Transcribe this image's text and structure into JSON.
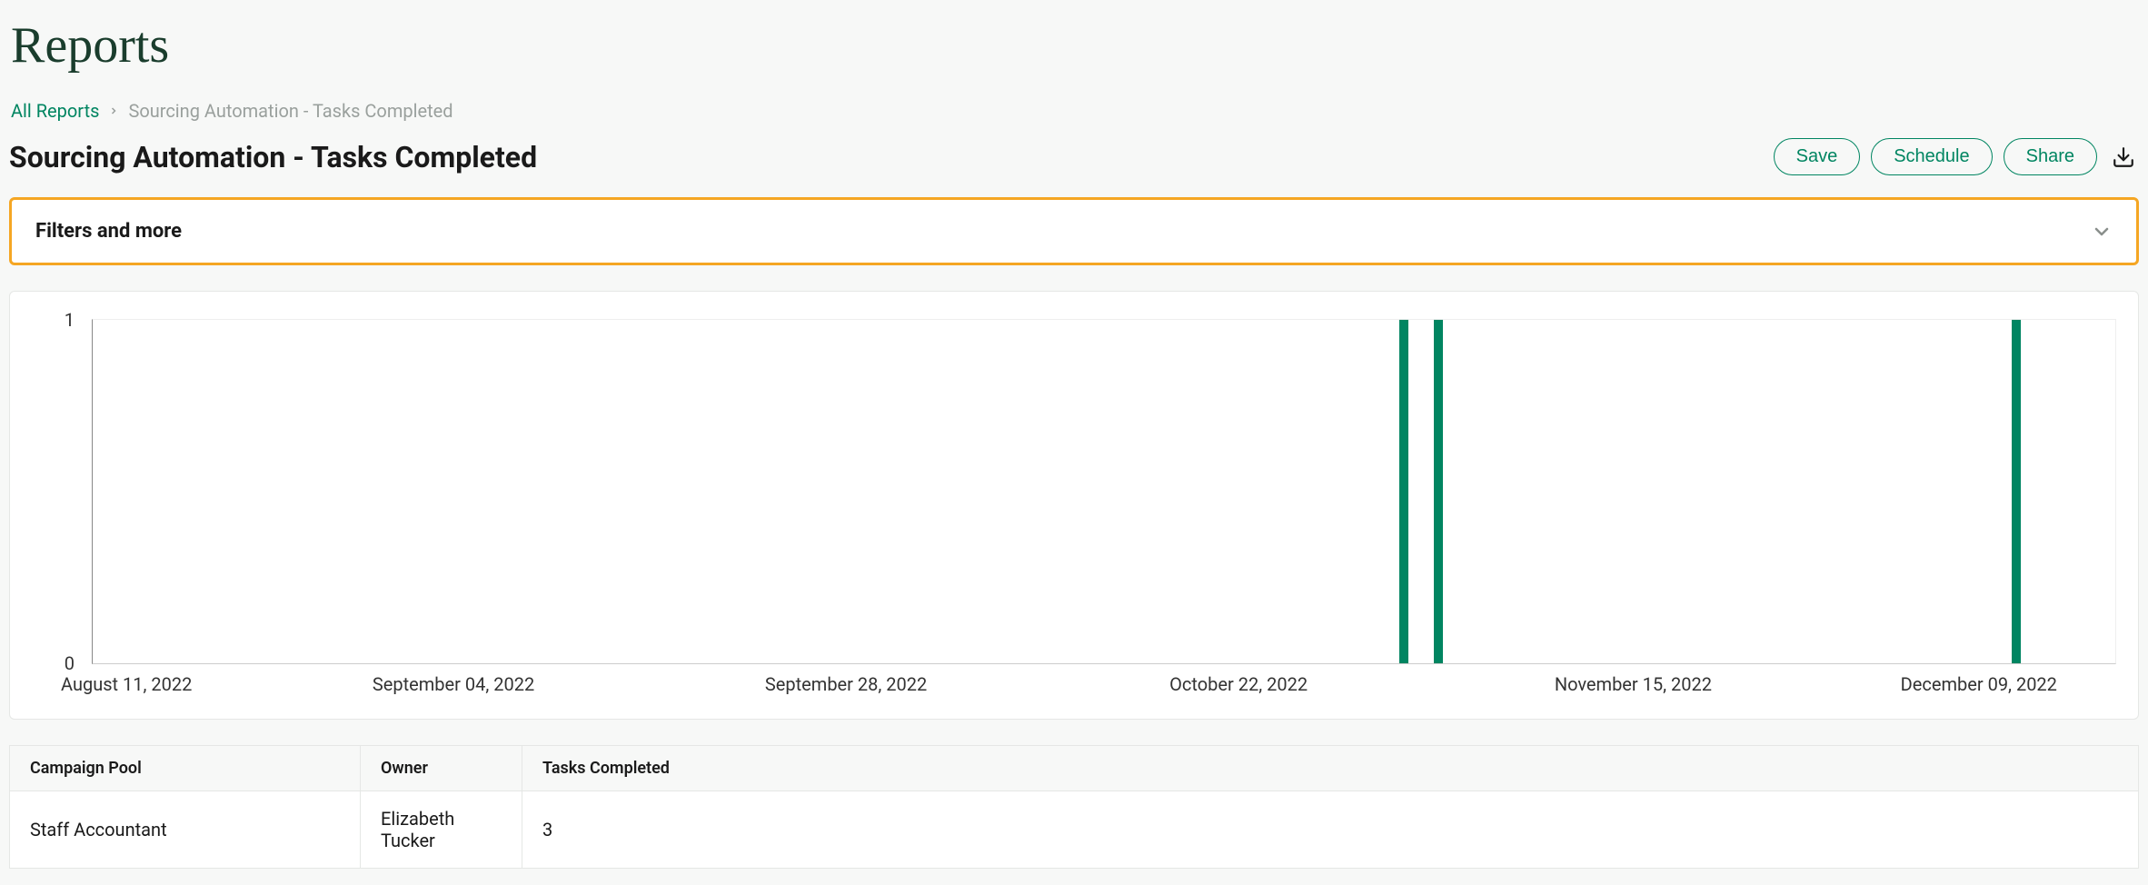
{
  "page": {
    "title": "Reports"
  },
  "breadcrumb": {
    "root": "All Reports",
    "current": "Sourcing Automation - Tasks Completed"
  },
  "report": {
    "title": "Sourcing Automation - Tasks Completed"
  },
  "actions": {
    "save": "Save",
    "schedule": "Schedule",
    "share": "Share"
  },
  "filters": {
    "label": "Filters and more"
  },
  "table": {
    "columns": [
      "Campaign Pool",
      "Owner",
      "Tasks Completed"
    ],
    "rows": [
      {
        "campaign_pool": "Staff Accountant",
        "owner": "Elizabeth Tucker",
        "tasks_completed": "3"
      }
    ]
  },
  "chart_data": {
    "type": "bar",
    "title": "",
    "xlabel": "",
    "ylabel": "",
    "ylim": [
      0,
      1
    ],
    "yticks": [
      0,
      1
    ],
    "x_tick_labels": [
      "August 11, 2022",
      "September 04, 2022",
      "September 28, 2022",
      "October 22, 2022",
      "November 15, 2022",
      "December 09, 2022"
    ],
    "x_tick_positions_pct": [
      0,
      19.1,
      38.2,
      57.3,
      76.5,
      95.6
    ],
    "bars": [
      {
        "x_pct": 64.6,
        "value": 1
      },
      {
        "x_pct": 66.3,
        "value": 1
      },
      {
        "x_pct": 94.9,
        "value": 1
      }
    ]
  }
}
